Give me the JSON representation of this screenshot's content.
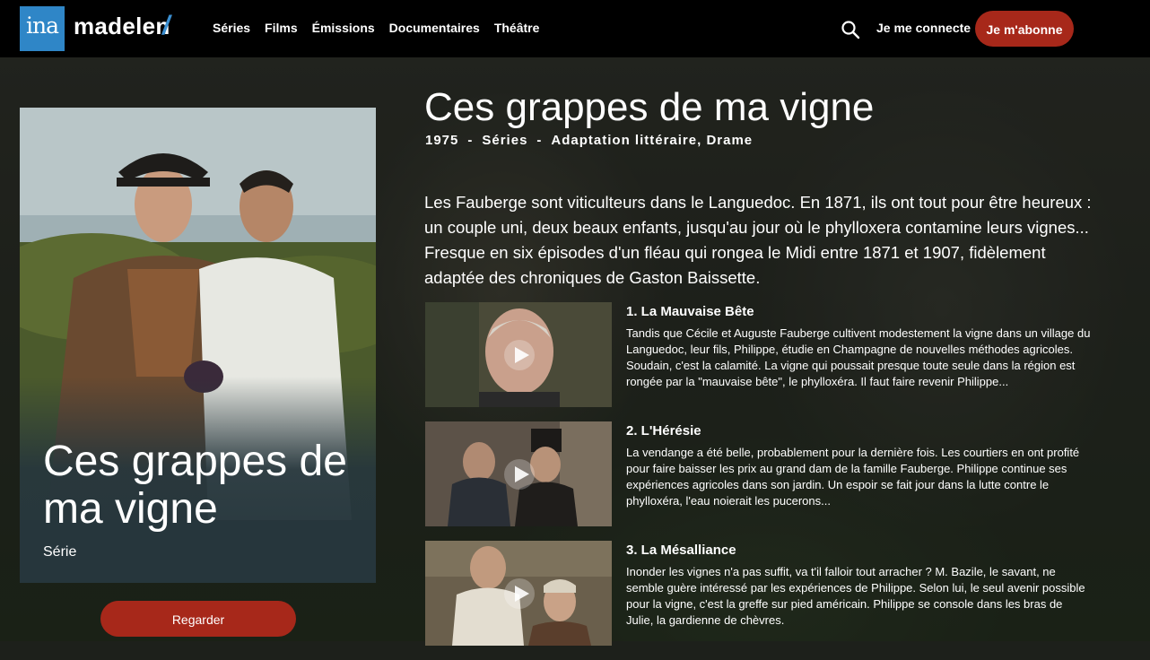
{
  "header": {
    "logo_ina": "ina",
    "logo_name": "madelen",
    "logo_slash": "/",
    "nav": [
      "Séries",
      "Films",
      "Émissions",
      "Documentaires",
      "Théâtre"
    ],
    "login_label": "Je me connecte",
    "subscribe_label": "Je m'abonne"
  },
  "poster": {
    "title": "Ces grappes de ma vigne",
    "type": "Série",
    "watch_label": "Regarder"
  },
  "program": {
    "title": "Ces grappes de ma vigne",
    "year": "1975",
    "category": "Séries",
    "genres": "Adaptation littéraire,  Drame",
    "separator": "-",
    "synopsis": "Les Fauberge sont viticulteurs dans le Languedoc. En 1871, ils ont tout pour être heureux : un couple uni, deux beaux enfants, jusqu'au jour où le phylloxera contamine leurs vignes... Fresque en six épisodes d'un fléau qui rongea le Midi entre 1871 et 1907,  fidèlement adaptée des chroniques de Gaston Baissette."
  },
  "episodes": [
    {
      "title": "1. La Mauvaise Bête",
      "description": "Tandis que Cécile et Auguste Fauberge cultivent modestement la vigne dans un village du Languedoc, leur fils, Philippe, étudie en Champagne de nouvelles méthodes agricoles. Soudain, c'est la calamité. La vigne qui poussait presque toute seule dans la région est rongée par la \"mauvaise bête\", le phylloxéra. Il faut faire revenir Philippe..."
    },
    {
      "title": "2. L'Hérésie",
      "description": "La vendange a été belle, probablement pour la dernière fois. Les courtiers en ont profité pour faire baisser les prix au grand dam de la famille Fauberge. Philippe continue ses expériences agricoles dans son jardin. Un espoir se fait jour dans la lutte contre le phylloxéra, l'eau noierait les pucerons..."
    },
    {
      "title": "3. La Mésalliance",
      "description": "Inonder les vignes n'a pas suffit, va t'il falloir tout arracher ? M. Bazile, le savant, ne semble guère intéressé par les expériences de Philippe. Selon lui, le seul avenir possible pour la vigne, c'est la greffe sur pied américain. Philippe se console dans les bras de Julie, la gardienne de chèvres."
    }
  ],
  "colors": {
    "accent_red": "#a7281a",
    "ina_blue": "#2f86c7",
    "poster_panel": "#26363c"
  }
}
